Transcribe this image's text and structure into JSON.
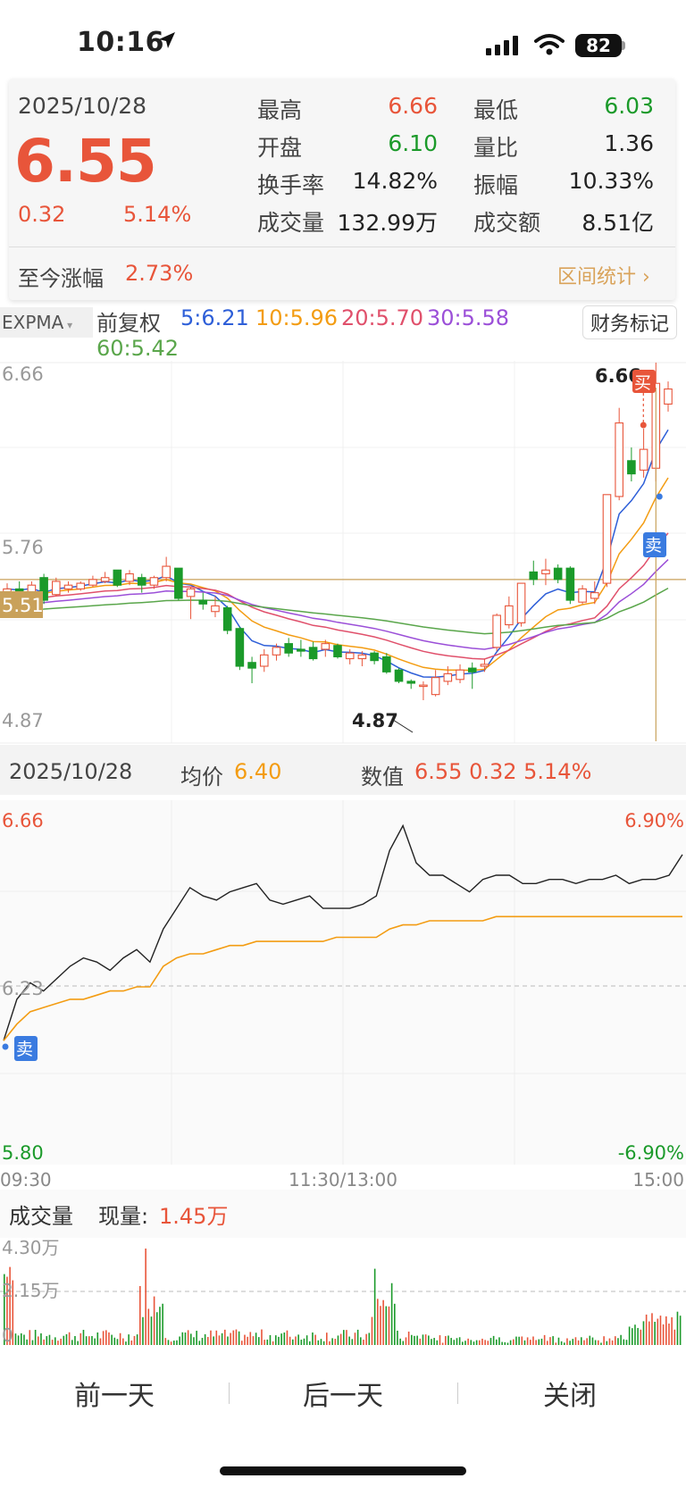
{
  "status_bar": {
    "time": "10:16",
    "battery": "82"
  },
  "card": {
    "date": "2025/10/28",
    "price": "6.55",
    "change": "0.32",
    "change_pct": "5.14%",
    "stats": [
      {
        "label": "最高",
        "value": "6.66",
        "color": "red"
      },
      {
        "label": "最低",
        "value": "6.03",
        "color": "green"
      },
      {
        "label": "开盘",
        "value": "6.10",
        "color": "green"
      },
      {
        "label": "量比",
        "value": "1.36",
        "color": "dark"
      },
      {
        "label": "换手率",
        "value": "14.82%",
        "color": "dark"
      },
      {
        "label": "振幅",
        "value": "10.33%",
        "color": "dark"
      },
      {
        "label": "成交量",
        "value": "132.99万",
        "color": "dark"
      },
      {
        "label": "成交额",
        "value": "8.51亿",
        "color": "dark"
      }
    ],
    "since_label": "至今涨幅",
    "since_value": "2.73%",
    "range_stats": "区间统计 ›"
  },
  "legend": {
    "indicator": "EXPMA",
    "adjust": "前复权",
    "ma": [
      {
        "text": "5:6.21",
        "color": "#2e5fd8"
      },
      {
        "text": "10:5.96",
        "color": "#f39c12"
      },
      {
        "text": "20:5.70",
        "color": "#e0506b"
      },
      {
        "text": "30:5.58",
        "color": "#9b4fd8"
      },
      {
        "text": "60:5.42",
        "color": "#5aa64b"
      }
    ],
    "finance_mark": "财务标记"
  },
  "kline_labels": {
    "y_high": "6.66",
    "y_mid": "5.76",
    "y_low": "4.87",
    "cursor_price": "5.51",
    "max_label": "6.66",
    "min_label": "4.87",
    "buy": "买",
    "sell": "卖"
  },
  "intraday_header": {
    "date": "2025/10/28",
    "avg_label": "均价",
    "avg_value": "6.40",
    "value_label": "数值",
    "value_text": "6.55 0.32 5.14%"
  },
  "chart_data": [
    {
      "type": "candlestick",
      "ylim": [
        4.87,
        6.66
      ],
      "highlight_price": 5.51,
      "candles": [
        {
          "o": 5.44,
          "c": 5.46,
          "h": 5.49,
          "l": 5.4
        },
        {
          "o": 5.46,
          "c": 5.44,
          "h": 5.5,
          "l": 5.42
        },
        {
          "o": 5.42,
          "c": 5.48,
          "h": 5.5,
          "l": 5.4
        },
        {
          "o": 5.52,
          "c": 5.4,
          "h": 5.54,
          "l": 5.38
        },
        {
          "o": 5.43,
          "c": 5.5,
          "h": 5.52,
          "l": 5.42
        },
        {
          "o": 5.46,
          "c": 5.48,
          "h": 5.5,
          "l": 5.44
        },
        {
          "o": 5.46,
          "c": 5.49,
          "h": 5.5,
          "l": 5.45
        },
        {
          "o": 5.48,
          "c": 5.51,
          "h": 5.53,
          "l": 5.47
        },
        {
          "o": 5.5,
          "c": 5.52,
          "h": 5.55,
          "l": 5.49
        },
        {
          "o": 5.56,
          "c": 5.48,
          "h": 5.56,
          "l": 5.47
        },
        {
          "o": 5.5,
          "c": 5.54,
          "h": 5.56,
          "l": 5.48
        },
        {
          "o": 5.52,
          "c": 5.48,
          "h": 5.54,
          "l": 5.44
        },
        {
          "o": 5.48,
          "c": 5.52,
          "h": 5.53,
          "l": 5.46
        },
        {
          "o": 5.52,
          "c": 5.58,
          "h": 5.63,
          "l": 5.5
        },
        {
          "o": 5.57,
          "c": 5.41,
          "h": 5.57,
          "l": 5.4
        },
        {
          "o": 5.42,
          "c": 5.46,
          "h": 5.47,
          "l": 5.3
        },
        {
          "o": 5.4,
          "c": 5.38,
          "h": 5.44,
          "l": 5.35
        },
        {
          "o": 5.34,
          "c": 5.37,
          "h": 5.42,
          "l": 5.31
        },
        {
          "o": 5.36,
          "c": 5.24,
          "h": 5.37,
          "l": 5.22
        },
        {
          "o": 5.25,
          "c": 5.05,
          "h": 5.26,
          "l": 5.03
        },
        {
          "o": 5.07,
          "c": 5.04,
          "h": 5.1,
          "l": 4.96
        },
        {
          "o": 5.05,
          "c": 5.11,
          "h": 5.14,
          "l": 5.02
        },
        {
          "o": 5.11,
          "c": 5.15,
          "h": 5.17,
          "l": 5.08
        },
        {
          "o": 5.17,
          "c": 5.12,
          "h": 5.2,
          "l": 5.1
        },
        {
          "o": 5.14,
          "c": 5.13,
          "h": 5.19,
          "l": 5.1
        },
        {
          "o": 5.15,
          "c": 5.09,
          "h": 5.18,
          "l": 5.08
        },
        {
          "o": 5.14,
          "c": 5.17,
          "h": 5.19,
          "l": 5.1
        },
        {
          "o": 5.16,
          "c": 5.1,
          "h": 5.17,
          "l": 5.09
        },
        {
          "o": 5.09,
          "c": 5.12,
          "h": 5.14,
          "l": 5.06
        },
        {
          "o": 5.09,
          "c": 5.11,
          "h": 5.13,
          "l": 5.05
        },
        {
          "o": 5.12,
          "c": 5.08,
          "h": 5.13,
          "l": 5.06
        },
        {
          "o": 5.1,
          "c": 5.02,
          "h": 5.12,
          "l": 5.01
        },
        {
          "o": 5.03,
          "c": 4.97,
          "h": 5.04,
          "l": 4.96
        },
        {
          "o": 4.97,
          "c": 4.96,
          "h": 4.98,
          "l": 4.93
        },
        {
          "o": 4.95,
          "c": 4.95,
          "h": 4.97,
          "l": 4.87
        },
        {
          "o": 4.9,
          "c": 4.99,
          "h": 5.03,
          "l": 4.89
        },
        {
          "o": 4.97,
          "c": 5.01,
          "h": 5.05,
          "l": 4.95
        },
        {
          "o": 4.98,
          "c": 5.03,
          "h": 5.06,
          "l": 4.96
        },
        {
          "o": 5.04,
          "c": 5.02,
          "h": 5.07,
          "l": 4.93
        },
        {
          "o": 5.05,
          "c": 5.06,
          "h": 5.09,
          "l": 5.02
        },
        {
          "o": 5.15,
          "c": 5.32,
          "h": 5.33,
          "l": 5.13
        },
        {
          "o": 5.27,
          "c": 5.37,
          "h": 5.42,
          "l": 5.25
        },
        {
          "o": 5.28,
          "c": 5.49,
          "h": 5.49,
          "l": 5.26
        },
        {
          "o": 5.55,
          "c": 5.51,
          "h": 5.61,
          "l": 5.48
        },
        {
          "o": 5.54,
          "c": 5.56,
          "h": 5.62,
          "l": 5.48
        },
        {
          "o": 5.57,
          "c": 5.51,
          "h": 5.59,
          "l": 5.49
        },
        {
          "o": 5.57,
          "c": 5.4,
          "h": 5.58,
          "l": 5.38
        },
        {
          "o": 5.39,
          "c": 5.46,
          "h": 5.48,
          "l": 5.38
        },
        {
          "o": 5.41,
          "c": 5.44,
          "h": 5.5,
          "l": 5.38
        },
        {
          "o": 5.49,
          "c": 5.96,
          "h": 5.96,
          "l": 5.47
        },
        {
          "o": 5.95,
          "c": 6.34,
          "h": 6.42,
          "l": 5.93
        },
        {
          "o": 6.14,
          "c": 6.07,
          "h": 6.21,
          "l": 6.03
        },
        {
          "o": 6.09,
          "c": 6.2,
          "h": 6.31,
          "l": 6.05
        },
        {
          "o": 6.1,
          "c": 6.55,
          "h": 6.66,
          "l": 6.03
        },
        {
          "o": 6.44,
          "c": 6.52,
          "h": 6.56,
          "l": 6.4
        }
      ],
      "sell_marker_index": 53,
      "buy_marker_index": 53
    },
    {
      "type": "line",
      "title": "",
      "ylim": [
        5.8,
        6.66
      ],
      "pct_range": [
        "6.90%",
        "-6.90%"
      ],
      "yref": 6.23,
      "x_ticks": [
        "09:30",
        "11:30/13:00",
        "15:00"
      ],
      "y_ticks": [
        "6.66",
        "6.23",
        "5.80"
      ],
      "series": [
        {
          "name": "",
          "color": "#222222",
          "values": [
            6.1,
            6.2,
            6.24,
            6.22,
            6.25,
            6.28,
            6.3,
            6.29,
            6.27,
            6.3,
            6.32,
            6.29,
            6.37,
            6.42,
            6.47,
            6.45,
            6.44,
            6.46,
            6.47,
            6.48,
            6.44,
            6.43,
            6.44,
            6.45,
            6.42,
            6.42,
            6.42,
            6.43,
            6.45,
            6.56,
            6.62,
            6.53,
            6.5,
            6.5,
            6.48,
            6.46,
            6.49,
            6.5,
            6.5,
            6.48,
            6.48,
            6.49,
            6.49,
            6.48,
            6.49,
            6.49,
            6.5,
            6.48,
            6.49,
            6.49,
            6.5,
            6.55
          ]
        },
        {
          "name": "均价",
          "color": "#f39c12",
          "values": [
            6.1,
            6.14,
            6.17,
            6.18,
            6.19,
            6.2,
            6.2,
            6.21,
            6.22,
            6.22,
            6.23,
            6.23,
            6.28,
            6.3,
            6.31,
            6.31,
            6.32,
            6.33,
            6.33,
            6.34,
            6.34,
            6.34,
            6.34,
            6.34,
            6.34,
            6.35,
            6.35,
            6.35,
            6.35,
            6.37,
            6.38,
            6.38,
            6.39,
            6.39,
            6.39,
            6.39,
            6.39,
            6.4,
            6.4,
            6.4,
            6.4,
            6.4,
            6.4,
            6.4,
            6.4,
            6.4,
            6.4,
            6.4,
            6.4,
            6.4,
            6.4,
            6.4
          ]
        }
      ]
    },
    {
      "type": "bar",
      "title": "成交量",
      "current_label": "现量:",
      "current_value": "1.45万",
      "y_ticks": [
        "4.30万",
        "2.15万",
        "0"
      ],
      "ylim": [
        0,
        4.3
      ]
    }
  ],
  "bottom_nav": {
    "prev": "前一天",
    "next": "后一天",
    "close": "关闭"
  }
}
